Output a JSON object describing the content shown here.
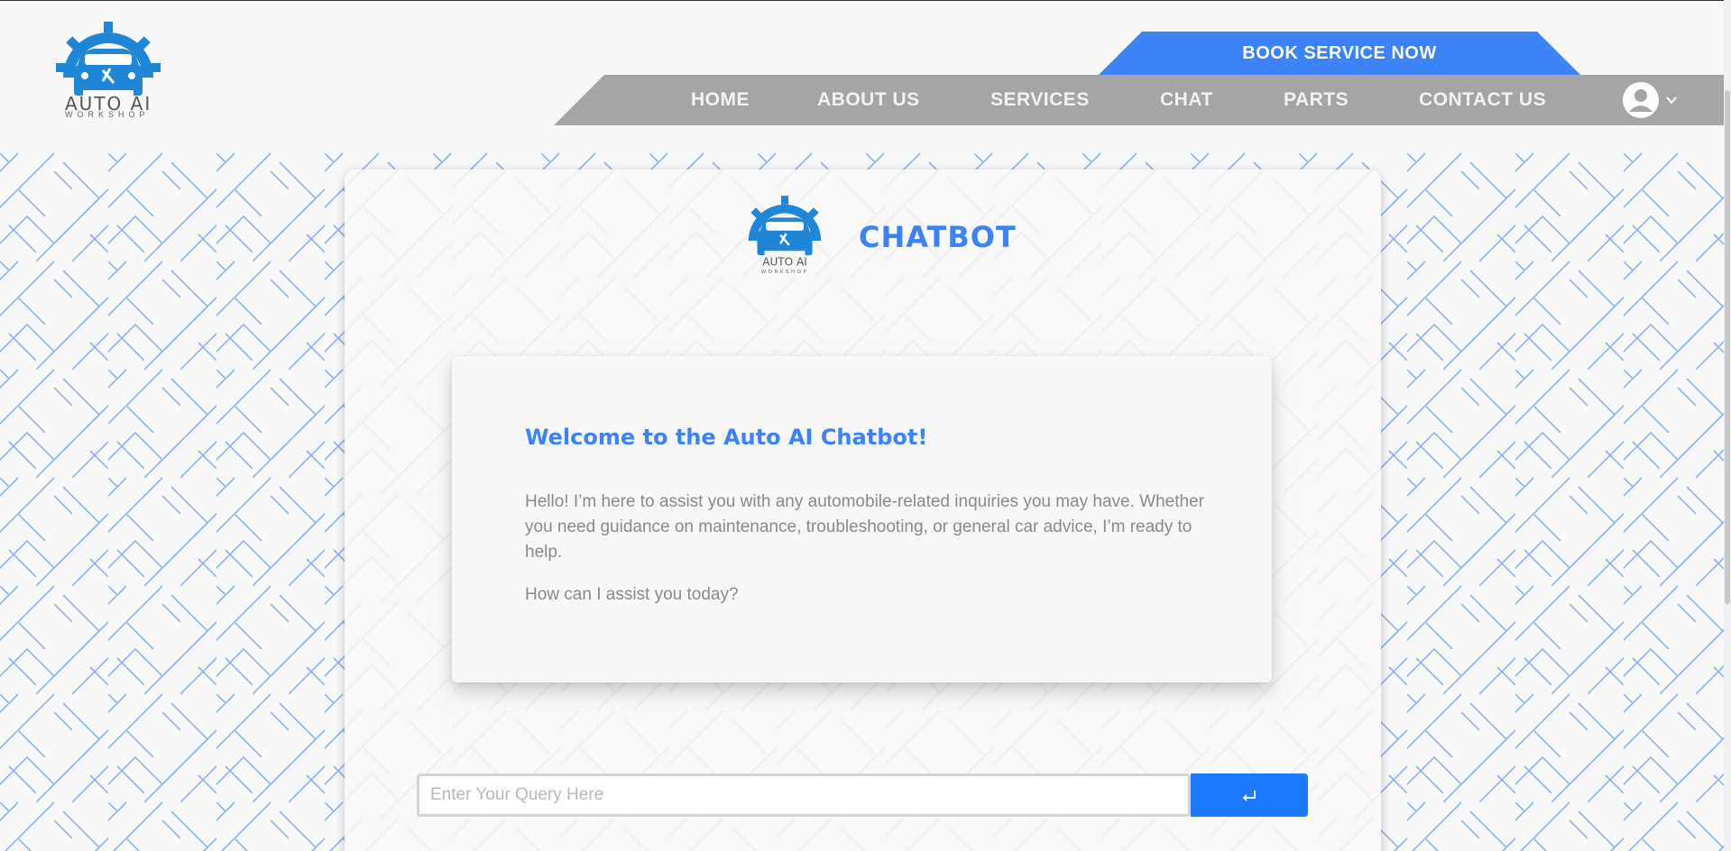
{
  "brand": {
    "name": "AUTO AI",
    "tagline": "WORKSHOP",
    "accent": "#3b83f6",
    "logo_icon": "car-gear-wrench-logo"
  },
  "header": {
    "cta_label": "BOOK SERVICE NOW",
    "nav": [
      {
        "label": "HOME"
      },
      {
        "label": "ABOUT US"
      },
      {
        "label": "SERVICES"
      },
      {
        "label": "CHAT"
      },
      {
        "label": "PARTS"
      },
      {
        "label": "CONTACT US"
      }
    ],
    "user_icon": "user-avatar-icon",
    "dropdown_icon": "chevron-down-icon"
  },
  "chat": {
    "title": "CHATBOT",
    "welcome_title": "Welcome to the Auto AI Chatbot!",
    "welcome_body": "Hello! I’m here to assist you with any automobile-related inquiries you may have. Whether you need guidance on maintenance, troubleshooting, or general car advice, I’m ready to help.",
    "welcome_question": "How can I assist you today?",
    "input": {
      "placeholder": "Enter Your Query Here",
      "value": ""
    },
    "send_icon": "enter-return-icon"
  }
}
